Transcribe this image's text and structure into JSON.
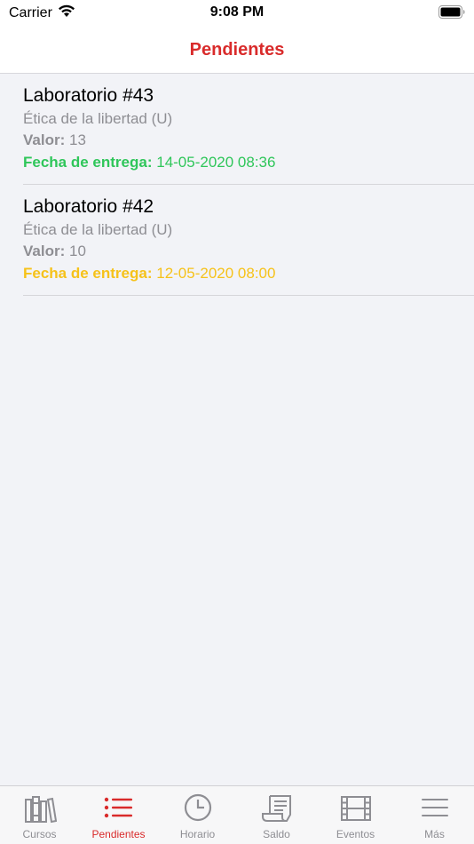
{
  "status_bar": {
    "carrier": "Carrier",
    "time": "9:08 PM"
  },
  "nav": {
    "title": "Pendientes"
  },
  "items": [
    {
      "title": "Laboratorio #43",
      "course": "Ética de la libertad (U)",
      "value_label": "Valor:",
      "value": "13",
      "due_label": "Fecha de entrega:",
      "due": "14-05-2020 08:36",
      "due_color": "#2fc65a"
    },
    {
      "title": "Laboratorio #42",
      "course": "Ética de la libertad (U)",
      "value_label": "Valor:",
      "value": "10",
      "due_label": "Fecha de entrega:",
      "due": "12-05-2020 08:00",
      "due_color": "#f6c21a"
    }
  ],
  "tabs": [
    {
      "label": "Cursos",
      "icon": "books-icon",
      "active": false
    },
    {
      "label": "Pendientes",
      "icon": "list-icon",
      "active": true
    },
    {
      "label": "Horario",
      "icon": "clock-icon",
      "active": false
    },
    {
      "label": "Saldo",
      "icon": "receipt-icon",
      "active": false
    },
    {
      "label": "Eventos",
      "icon": "film-icon",
      "active": false
    },
    {
      "label": "Más",
      "icon": "menu-icon",
      "active": false
    }
  ],
  "colors": {
    "accent": "#d92b2b",
    "inactive": "#8e8e93"
  }
}
